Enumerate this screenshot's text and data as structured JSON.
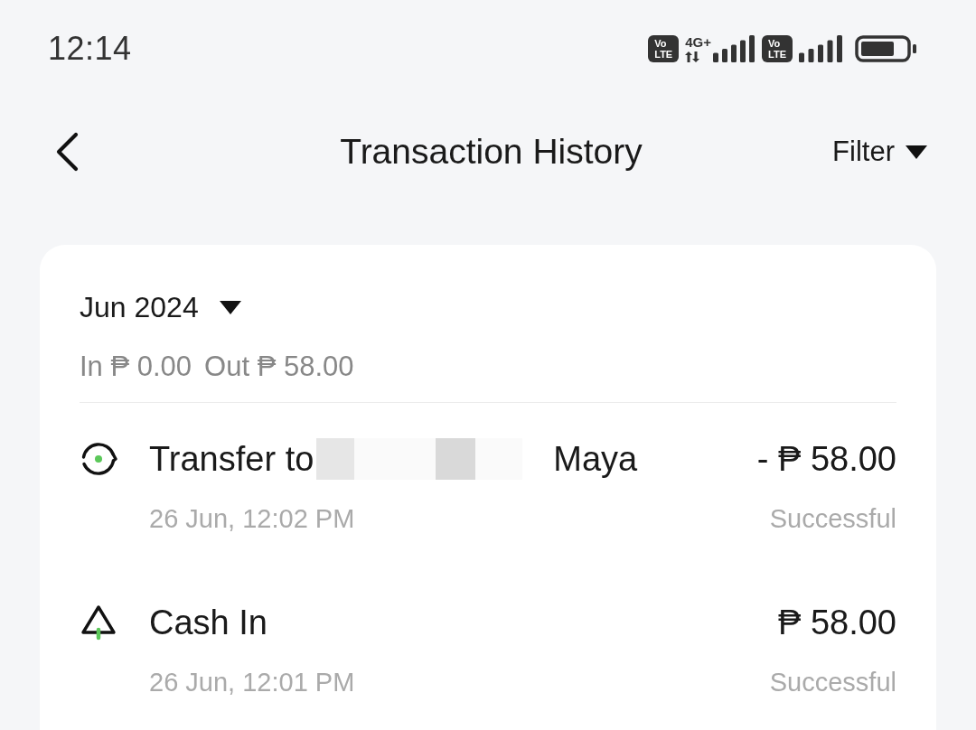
{
  "status_bar": {
    "time": "12:14",
    "sims": [
      {
        "volte_top": "Vo",
        "volte_bottom": "LTE",
        "network": "4G+"
      },
      {
        "volte_top": "Vo",
        "volte_bottom": "LTE"
      }
    ]
  },
  "header": {
    "title": "Transaction History",
    "filter": "Filter"
  },
  "month": {
    "label": "Jun 2024",
    "in_total": "In ₱ 0.00",
    "out_total": "Out ₱ 58.00"
  },
  "transactions": [
    {
      "kind": "transfer",
      "title": "Transfer to",
      "redacted": true,
      "title_suffix": "Maya",
      "amount": "- ₱ 58.00",
      "date": "26 Jun, 12:02 PM",
      "status": "Successful"
    },
    {
      "kind": "cash_in",
      "title": "Cash In",
      "redacted": false,
      "amount": "₱ 58.00",
      "date": "26 Jun, 12:01 PM",
      "status": "Successful"
    }
  ]
}
